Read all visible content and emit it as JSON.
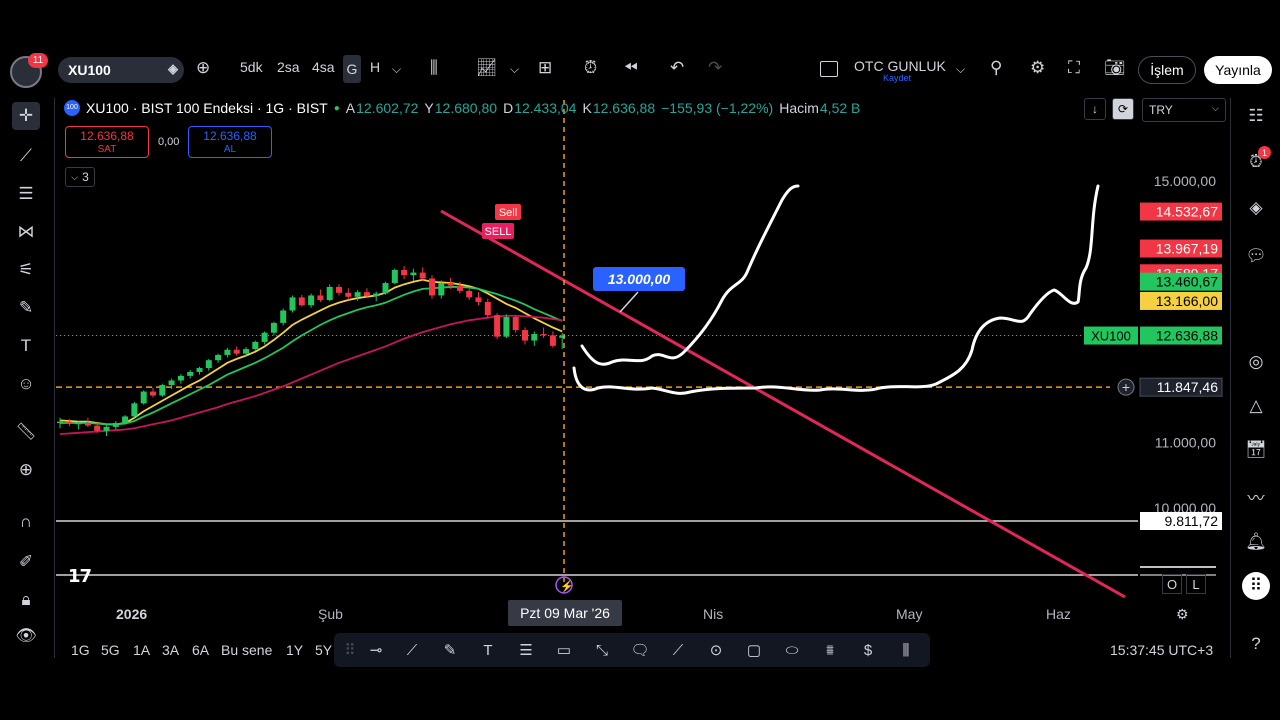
{
  "header": {
    "notification_count": "11",
    "symbol": "XU100",
    "intervals": [
      "5dk",
      "2sa",
      "4sa",
      "G",
      "H"
    ],
    "active_interval": "G",
    "layout_name": "OTC GUNLUK",
    "layout_sub": "Kaydet",
    "islem_label": "İşlem",
    "publish_label": "Yayınla"
  },
  "legend": {
    "title": "XU100 · BIST 100 Endeksi · 1G · BIST",
    "o_label": "A",
    "o_value": "12.602,72",
    "h_label": "Y",
    "h_value": "12.680,80",
    "l_label": "D",
    "l_value": "12.433,04",
    "c_label": "K",
    "c_value": "12.636,88",
    "change": "−155,93 (−1,22%)",
    "volume_label": "Hacim",
    "volume_value": "4,52 B",
    "sell_price": "12.636,88",
    "sell_label": "SAT",
    "spread": "0,00",
    "buy_price": "12.636,88",
    "buy_label": "AL",
    "indicators_collapsed": "3",
    "currency": "TRY"
  },
  "chart_data": {
    "type": "line",
    "title": "XU100 · BIST 100 Endeksi · 1G · BIST",
    "x_tick_labels": [
      "2026",
      "Şub",
      "Nis",
      "May",
      "Haz"
    ],
    "crosshair_x_label": "Pzt 09 Mar '26",
    "y_tick_labels": [
      "15.000,00",
      "11.000,00",
      "10.000,00"
    ],
    "ylim": [
      9300,
      15100
    ],
    "candles": [
      {
        "o": 11300,
        "h": 11380,
        "l": 11220,
        "c": 11320
      },
      {
        "o": 11320,
        "h": 11360,
        "l": 11250,
        "c": 11290
      },
      {
        "o": 11280,
        "h": 11330,
        "l": 11200,
        "c": 11300
      },
      {
        "o": 11300,
        "h": 11380,
        "l": 11240,
        "c": 11260
      },
      {
        "o": 11260,
        "h": 11300,
        "l": 11150,
        "c": 11180
      },
      {
        "o": 11180,
        "h": 11260,
        "l": 11100,
        "c": 11240
      },
      {
        "o": 11240,
        "h": 11330,
        "l": 11200,
        "c": 11300
      },
      {
        "o": 11300,
        "h": 11420,
        "l": 11280,
        "c": 11400
      },
      {
        "o": 11400,
        "h": 11620,
        "l": 11380,
        "c": 11600
      },
      {
        "o": 11600,
        "h": 11800,
        "l": 11580,
        "c": 11780
      },
      {
        "o": 11780,
        "h": 11840,
        "l": 11690,
        "c": 11720
      },
      {
        "o": 11720,
        "h": 11900,
        "l": 11700,
        "c": 11880
      },
      {
        "o": 11880,
        "h": 11980,
        "l": 11820,
        "c": 11950
      },
      {
        "o": 11950,
        "h": 12050,
        "l": 11900,
        "c": 12020
      },
      {
        "o": 12020,
        "h": 12110,
        "l": 11980,
        "c": 12080
      },
      {
        "o": 12080,
        "h": 12160,
        "l": 12040,
        "c": 12140
      },
      {
        "o": 12140,
        "h": 12280,
        "l": 12100,
        "c": 12260
      },
      {
        "o": 12260,
        "h": 12360,
        "l": 12220,
        "c": 12340
      },
      {
        "o": 12340,
        "h": 12450,
        "l": 12300,
        "c": 12420
      },
      {
        "o": 12420,
        "h": 12470,
        "l": 12330,
        "c": 12360
      },
      {
        "o": 12360,
        "h": 12460,
        "l": 12320,
        "c": 12430
      },
      {
        "o": 12430,
        "h": 12560,
        "l": 12400,
        "c": 12540
      },
      {
        "o": 12540,
        "h": 12700,
        "l": 12500,
        "c": 12680
      },
      {
        "o": 12680,
        "h": 12850,
        "l": 12640,
        "c": 12830
      },
      {
        "o": 12830,
        "h": 13050,
        "l": 12790,
        "c": 13020
      },
      {
        "o": 13020,
        "h": 13250,
        "l": 12990,
        "c": 13220
      },
      {
        "o": 13220,
        "h": 13260,
        "l": 13080,
        "c": 13100
      },
      {
        "o": 13100,
        "h": 13280,
        "l": 13060,
        "c": 13250
      },
      {
        "o": 13250,
        "h": 13340,
        "l": 13150,
        "c": 13180
      },
      {
        "o": 13180,
        "h": 13420,
        "l": 13160,
        "c": 13380
      },
      {
        "o": 13380,
        "h": 13420,
        "l": 13250,
        "c": 13290
      },
      {
        "o": 13290,
        "h": 13360,
        "l": 13180,
        "c": 13230
      },
      {
        "o": 13230,
        "h": 13330,
        "l": 13170,
        "c": 13300
      },
      {
        "o": 13300,
        "h": 13360,
        "l": 13210,
        "c": 13240
      },
      {
        "o": 13240,
        "h": 13310,
        "l": 13160,
        "c": 13280
      },
      {
        "o": 13280,
        "h": 13460,
        "l": 13260,
        "c": 13440
      },
      {
        "o": 13440,
        "h": 13660,
        "l": 13420,
        "c": 13640
      },
      {
        "o": 13640,
        "h": 13700,
        "l": 13500,
        "c": 13560
      },
      {
        "o": 13560,
        "h": 13660,
        "l": 13470,
        "c": 13600
      },
      {
        "o": 13600,
        "h": 13680,
        "l": 13480,
        "c": 13510
      },
      {
        "o": 13510,
        "h": 13560,
        "l": 13200,
        "c": 13250
      },
      {
        "o": 13250,
        "h": 13480,
        "l": 13200,
        "c": 13440
      },
      {
        "o": 13440,
        "h": 13520,
        "l": 13350,
        "c": 13400
      },
      {
        "o": 13400,
        "h": 13460,
        "l": 13280,
        "c": 13320
      },
      {
        "o": 13320,
        "h": 13350,
        "l": 13180,
        "c": 13220
      },
      {
        "o": 13220,
        "h": 13300,
        "l": 13100,
        "c": 13150
      },
      {
        "o": 13150,
        "h": 13200,
        "l": 12900,
        "c": 12950
      },
      {
        "o": 12950,
        "h": 12980,
        "l": 12580,
        "c": 12620
      },
      {
        "o": 12620,
        "h": 12960,
        "l": 12600,
        "c": 12920
      },
      {
        "o": 12920,
        "h": 12940,
        "l": 12680,
        "c": 12720
      },
      {
        "o": 12720,
        "h": 12760,
        "l": 12500,
        "c": 12560
      },
      {
        "o": 12560,
        "h": 12700,
        "l": 12480,
        "c": 12660
      },
      {
        "o": 12660,
        "h": 12760,
        "l": 12600,
        "c": 12640
      },
      {
        "o": 12640,
        "h": 12700,
        "l": 12450,
        "c": 12480
      },
      {
        "o": 12602.72,
        "h": 12680.8,
        "l": 12433.04,
        "c": 12636.88
      }
    ],
    "series": [
      {
        "color": "#f5d142",
        "values": [
          11340,
          11330,
          11320,
          11320,
          11300,
          11280,
          11280,
          11300,
          11380,
          11480,
          11560,
          11640,
          11720,
          11800,
          11880,
          11950,
          12040,
          12130,
          12220,
          12280,
          12330,
          12390,
          12470,
          12570,
          12680,
          12800,
          12880,
          12950,
          13020,
          13090,
          13140,
          13180,
          13210,
          13230,
          13250,
          13290,
          13370,
          13420,
          13460,
          13490,
          13460,
          13450,
          13440,
          13420,
          13390,
          13350,
          13280,
          13200,
          13120,
          13060,
          12980,
          12900,
          12830,
          12760,
          12700
        ]
      },
      {
        "color": "#22c55e",
        "values": [
          11300,
          11300,
          11300,
          11300,
          11290,
          11280,
          11280,
          11290,
          11330,
          11400,
          11460,
          11530,
          11600,
          11670,
          11740,
          11810,
          11880,
          11960,
          12040,
          12100,
          12160,
          12220,
          12290,
          12370,
          12450,
          12550,
          12640,
          12720,
          12800,
          12870,
          12930,
          12980,
          13030,
          13070,
          13100,
          13140,
          13200,
          13260,
          13310,
          13350,
          13360,
          13370,
          13380,
          13380,
          13370,
          13350,
          13310,
          13270,
          13220,
          13170,
          13110,
          13040,
          12980,
          12920,
          12860
        ]
      },
      {
        "color": "#c2185b",
        "values": [
          11130,
          11140,
          11150,
          11160,
          11170,
          11180,
          11190,
          11200,
          11220,
          11250,
          11280,
          11310,
          11340,
          11380,
          11420,
          11460,
          11500,
          11540,
          11590,
          11630,
          11670,
          11710,
          11760,
          11810,
          11860,
          11920,
          11980,
          12040,
          12100,
          12160,
          12220,
          12270,
          12320,
          12370,
          12420,
          12470,
          12530,
          12590,
          12640,
          12690,
          12730,
          12770,
          12810,
          12840,
          12870,
          12890,
          12910,
          12930,
          12940,
          12940,
          12930,
          12920,
          12910,
          12890,
          12870
        ]
      }
    ],
    "price_labels": [
      {
        "text": "14.532,67",
        "bg": "#f23645",
        "fg": "#ffffff",
        "value": 14532.67
      },
      {
        "text": "13.967,19",
        "bg": "#f23645",
        "fg": "#ffffff",
        "value": 13967.19
      },
      {
        "text": "13.589,17",
        "bg": "#f23645",
        "fg": "#ffffff",
        "value": 13589.17
      },
      {
        "text": "13.460,67",
        "bg": "#22c55e",
        "fg": "#000000",
        "value": 13460.67
      },
      {
        "text": "13.166,00",
        "bg": "#f5d142",
        "fg": "#000000",
        "value": 13166.0
      },
      {
        "text": "12.636,88",
        "bg": "#22c55e",
        "fg": "#000000",
        "value": 12636.88
      },
      {
        "text": "11.847,46",
        "bg": "#1e222d",
        "fg": "#ffffff",
        "value": 11847.46
      },
      {
        "text": "9.811,72",
        "bg": "#ffffff",
        "fg": "#000000",
        "value": 9811.72
      }
    ],
    "current_symbol_label": "XU100",
    "annotation_label": "13.000,00",
    "signal_labels": [
      "Sell",
      "SELL"
    ]
  },
  "bottom": {
    "timeframes": [
      "1G",
      "5G",
      "1A",
      "3A",
      "6A",
      "Bu sene",
      "1Y",
      "5Y"
    ],
    "clock": "15:37:45 UTC+3",
    "ol_o": "O",
    "ol_l": "L"
  },
  "colors": {
    "up": "#22c55e",
    "down": "#f23645",
    "trendline": "#e2265a",
    "crosshair": "#f59e0b"
  }
}
